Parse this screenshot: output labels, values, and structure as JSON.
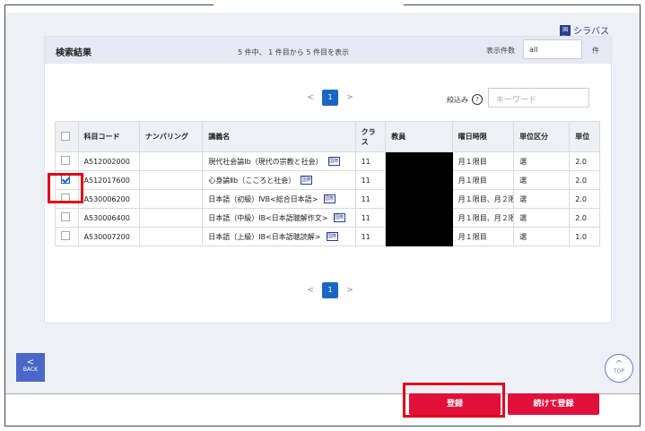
{
  "syllabus_label": "シラバス",
  "syllabus_icon_text": "国際",
  "header": {
    "title": "検索結果",
    "count_text": "5 件中、 1 件目から 5 件目を表示",
    "shownum_label": "表示件数",
    "shownum_value": "all",
    "unit": "件"
  },
  "pager": {
    "prev": "<",
    "page": "1",
    "next": ">"
  },
  "filter": {
    "label": "絞込み",
    "help": "?",
    "placeholder": "キーワード"
  },
  "columns": [
    "科目コード",
    "ナンバリング",
    "講義名",
    "クラス",
    "教員",
    "曜日時限",
    "単位区分",
    "単位"
  ],
  "rows": [
    {
      "code": "A512002000",
      "num": "",
      "name": "現代社会論Ⅰb（現代の宗教と社会）",
      "cls": "11",
      "day": "月１限目",
      "cat": "選",
      "credit": "2.0"
    },
    {
      "code": "A512017600",
      "num": "",
      "name": "心身論Ⅱb（こころと社会）",
      "cls": "11",
      "day": "月１限目",
      "cat": "選",
      "credit": "2.0"
    },
    {
      "code": "A530006200",
      "num": "",
      "name": "日本語（初級）ⅣB<総合日本語>",
      "cls": "11",
      "day": "月１限目、月２限",
      "cat": "選",
      "credit": "2.0"
    },
    {
      "code": "A530006400",
      "num": "",
      "name": "日本語（中級）ⅠB<日本語聴解作文>",
      "cls": "11",
      "day": "月１限目、月２限",
      "cat": "選",
      "credit": "2.0"
    },
    {
      "code": "A530007200",
      "num": "",
      "name": "日本語（上級）ⅠB<日本語聴読解>",
      "cls": "11",
      "day": "月１限目",
      "cat": "選",
      "credit": "1.0"
    }
  ],
  "back_label": "BACK",
  "top_label": "TOP",
  "register_label": "登録",
  "continue_label": "続けて登録",
  "colors": {
    "accent": "#1a66c4",
    "register": "#e0103a",
    "highlight": "#e0001a"
  }
}
